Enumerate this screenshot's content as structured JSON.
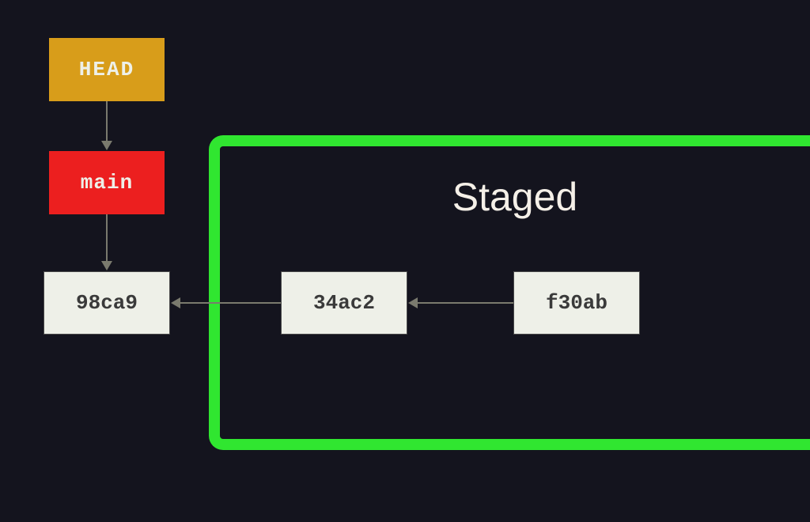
{
  "nodes": {
    "head": {
      "label": "HEAD",
      "color": "#d89d1a"
    },
    "main": {
      "label": "main",
      "color": "#ec1f1f"
    },
    "commit1": {
      "label": "98ca9",
      "color": "#eef0e8"
    },
    "commit2": {
      "label": "34ac2",
      "color": "#eef0e8"
    },
    "commit3": {
      "label": "f30ab",
      "color": "#eef0e8"
    }
  },
  "staged": {
    "label": "Staged",
    "border_color": "#30e630"
  },
  "arrows": [
    {
      "from": "head",
      "to": "main",
      "direction": "down"
    },
    {
      "from": "main",
      "to": "commit1",
      "direction": "down"
    },
    {
      "from": "commit2",
      "to": "commit1",
      "direction": "left"
    },
    {
      "from": "commit3",
      "to": "commit2",
      "direction": "left"
    }
  ],
  "background": "#14141e"
}
